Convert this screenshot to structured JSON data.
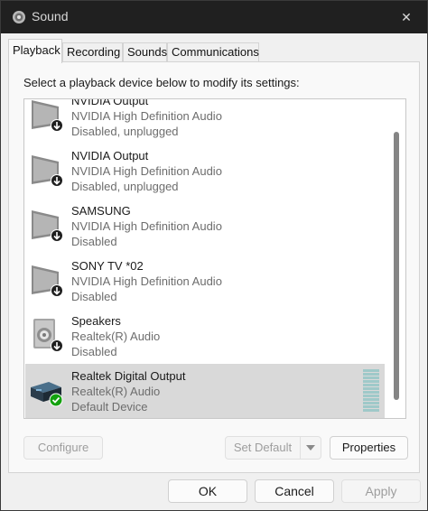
{
  "window": {
    "title": "Sound",
    "close_glyph": "✕"
  },
  "tabs": [
    {
      "label": "Playback",
      "active": true
    },
    {
      "label": "Recording",
      "active": false
    },
    {
      "label": "Sounds",
      "active": false
    },
    {
      "label": "Communications",
      "active": false
    }
  ],
  "panel": {
    "instruction": "Select a playback device below to modify its settings:"
  },
  "devices": [
    {
      "name": "NVIDIA Output",
      "driver": "NVIDIA High Definition Audio",
      "status": "Disabled, unplugged",
      "icon": "monitor-disabled-icon"
    },
    {
      "name": "NVIDIA Output",
      "driver": "NVIDIA High Definition Audio",
      "status": "Disabled, unplugged",
      "icon": "monitor-disabled-icon"
    },
    {
      "name": "SAMSUNG",
      "driver": "NVIDIA High Definition Audio",
      "status": "Disabled",
      "icon": "monitor-disabled-icon"
    },
    {
      "name": "SONY TV  *02",
      "driver": "NVIDIA High Definition Audio",
      "status": "Disabled",
      "icon": "monitor-disabled-icon"
    },
    {
      "name": "Speakers",
      "driver": "Realtek(R) Audio",
      "status": "Disabled",
      "icon": "speaker-disabled-icon"
    },
    {
      "name": "Realtek Digital Output",
      "driver": "Realtek(R) Audio",
      "status": "Default Device",
      "icon": "digital-output-default-icon",
      "selected": true
    }
  ],
  "buttons": {
    "configure": "Configure",
    "set_default": "Set Default",
    "properties": "Properties",
    "ok": "OK",
    "cancel": "Cancel",
    "apply": "Apply"
  },
  "colors": {
    "titlebar": "#202020",
    "selected_row": "#d9d9d9",
    "default_check": "#13a10e",
    "level_meter": "#9fc9c9"
  }
}
